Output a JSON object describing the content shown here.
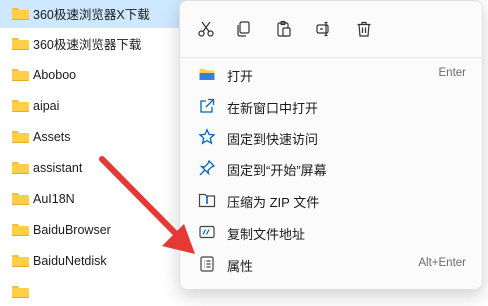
{
  "files": [
    {
      "name": "360极速浏览器X下载",
      "selected": true
    },
    {
      "name": "360极速浏览器下载"
    },
    {
      "name": "Aboboo"
    },
    {
      "name": "aipai"
    },
    {
      "name": "Assets"
    },
    {
      "name": "assistant"
    },
    {
      "name": "AuI18N"
    },
    {
      "name": "BaiduBrowser"
    },
    {
      "name": "BaiduNetdisk"
    }
  ],
  "toolbar": [
    {
      "icon": "scissors-icon",
      "action": "cut"
    },
    {
      "icon": "copy-icon",
      "action": "copy"
    },
    {
      "icon": "paste-icon",
      "action": "paste"
    },
    {
      "icon": "rename-icon",
      "action": "rename"
    },
    {
      "icon": "trash-icon",
      "action": "delete"
    }
  ],
  "menu": {
    "open": {
      "label": "打开",
      "shortcut": "Enter",
      "icon": "folder-open-icon"
    },
    "open_new_window": {
      "label": "在新窗口中打开",
      "icon": "external-link-icon"
    },
    "pin_quick_access": {
      "label": "固定到快速访问",
      "icon": "star-icon"
    },
    "pin_start": {
      "label": "固定到“开始”屏幕",
      "icon": "pin-icon"
    },
    "compress_zip": {
      "label": "压缩为 ZIP 文件",
      "icon": "zip-folder-icon"
    },
    "copy_path": {
      "label": "复制文件地址",
      "icon": "copy-path-icon"
    },
    "properties": {
      "label": "属性",
      "shortcut": "Alt+Enter",
      "icon": "properties-icon"
    }
  },
  "colors": {
    "accent": "#0067c0",
    "selection": "#cde8ff",
    "arrow": "#e53935",
    "folder": "#ffcf48"
  }
}
